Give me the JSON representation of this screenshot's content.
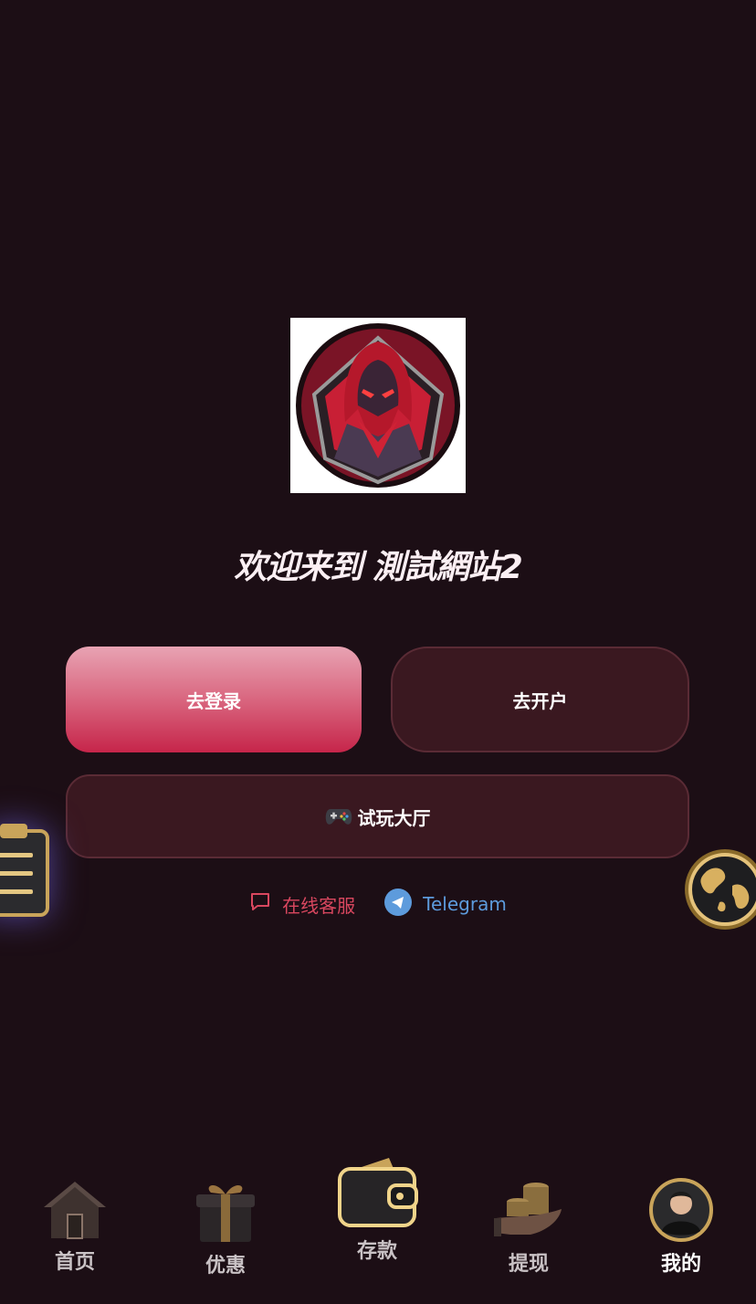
{
  "welcome": {
    "text": "欢迎来到 測試網站2"
  },
  "actions": {
    "login_label": "去登录",
    "register_label": "去开户",
    "demo_label": "试玩大厅"
  },
  "links": {
    "service_label": "在线客服",
    "telegram_label": "Telegram"
  },
  "tabbar": {
    "items": [
      {
        "label": "首页",
        "icon": "home-icon"
      },
      {
        "label": "优惠",
        "icon": "gift-icon"
      },
      {
        "label": "存款",
        "icon": "wallet-icon"
      },
      {
        "label": "提现",
        "icon": "coins-hand-icon"
      },
      {
        "label": "我的",
        "icon": "avatar-icon",
        "active": true
      }
    ]
  },
  "colors": {
    "background": "#1c0e15",
    "primary_gradient_top": "#e8a3b3",
    "primary_gradient_bottom": "#c6254a",
    "secondary_button": "#3a1820",
    "service_link": "#d9475f",
    "telegram_link": "#5d9bdc"
  }
}
